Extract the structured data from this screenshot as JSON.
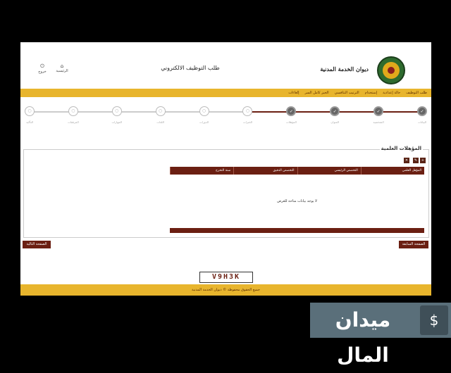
{
  "header": {
    "title": "طلب التوظيف الالكتروني",
    "org_name": "ديوان الخدمة المدنية",
    "links": [
      {
        "label": "الرئيسية",
        "glyph": "⌂"
      },
      {
        "label": "خروج",
        "glyph": "⏻"
      }
    ]
  },
  "menu": {
    "items": [
      "طلب التوظيف",
      "حالة إعدادية",
      "إستخدام",
      "الترتيب التنافسي",
      "الحيز كامل السر",
      "إلغاءات"
    ]
  },
  "steps": {
    "completed_count": 4,
    "items": [
      {
        "label": "البيانات",
        "glyph": "✓"
      },
      {
        "label": "الشخصية",
        "glyph": "✓"
      },
      {
        "label": "العنوان",
        "glyph": "✓"
      },
      {
        "label": "المؤهلات",
        "glyph": "✓"
      },
      {
        "label": "الخبرات",
        "glyph": "○"
      },
      {
        "label": "الدورات",
        "glyph": "○"
      },
      {
        "label": "اللغات",
        "glyph": "○"
      },
      {
        "label": "المهارات",
        "glyph": "○"
      },
      {
        "label": "المرفقات",
        "glyph": "○"
      },
      {
        "label": "التأكيد",
        "glyph": "○"
      }
    ]
  },
  "qualifications": {
    "title": "المؤهلات العلمية",
    "buttons": [
      {
        "glyph": "+"
      },
      {
        "glyph": "✎"
      },
      {
        "glyph": "✕"
      }
    ],
    "columns": [
      "المؤهل العلمي",
      "التخصص الرئيسي",
      "التخصص الدقيق",
      "سنة التخرج"
    ],
    "empty_message": "لا يوجد بيانات متاحة للعرض"
  },
  "nav": {
    "prev_label": "الصفحة السابقة",
    "next_label": "الصفحة التالية"
  },
  "captcha": {
    "text": "V9H3K"
  },
  "footer": {
    "text": "جميع الحقوق محفوظة © ديوان الخدمة المدنية"
  },
  "watermark": {
    "text": "ميدان المال",
    "logo_glyph": "$"
  },
  "colors": {
    "accent": "#e8b52d",
    "primary": "#6b1f12"
  }
}
